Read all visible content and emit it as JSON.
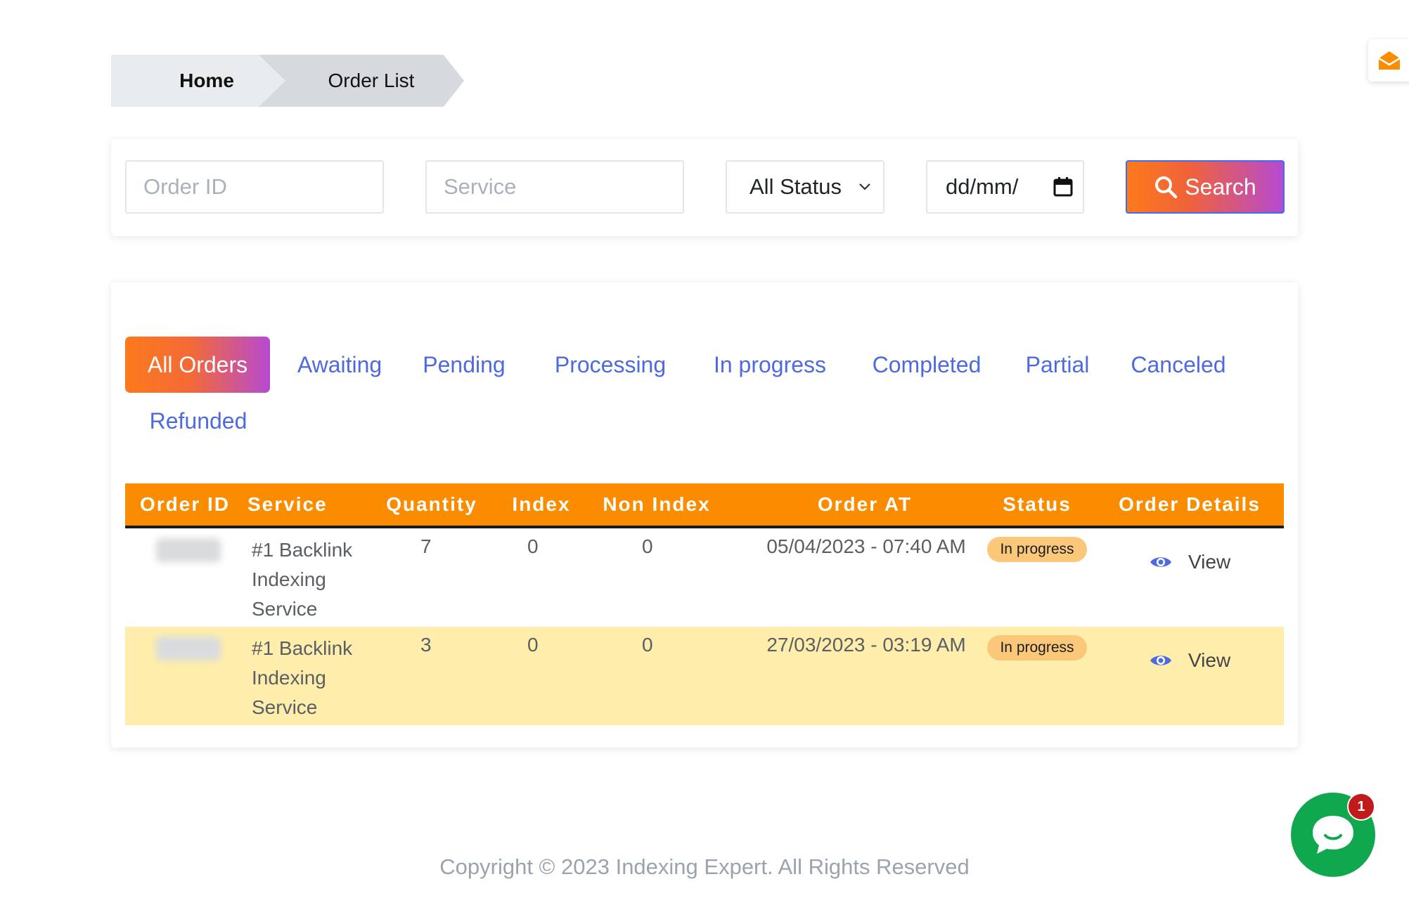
{
  "breadcrumb": {
    "home": "Home",
    "current": "Order List"
  },
  "filters": {
    "order_id_placeholder": "Order ID",
    "service_placeholder": "Service",
    "status_selected": "All Status",
    "date_placeholder": "dd/mm/yyyy",
    "date_display": "dd/mm/",
    "search_label": "Search"
  },
  "tabs": [
    {
      "label": "All Orders",
      "active": true
    },
    {
      "label": "Awaiting"
    },
    {
      "label": "Pending"
    },
    {
      "label": "Processing"
    },
    {
      "label": "In progress"
    },
    {
      "label": "Completed"
    },
    {
      "label": "Partial"
    },
    {
      "label": "Canceled"
    },
    {
      "label": "Refunded"
    }
  ],
  "table": {
    "headers": [
      "Order ID",
      "Service",
      "Quantity",
      "Index",
      "Non Index",
      "Order AT",
      "Status",
      "Order Details"
    ],
    "rows": [
      {
        "service_line1": "#1 Backlink",
        "service_line2": "Indexing",
        "service_line3": "Service",
        "quantity": "7",
        "index": "0",
        "non_index": "0",
        "order_at": "05/04/2023 - 07:40 AM",
        "status": "In progress",
        "details": "View"
      },
      {
        "service_line1": "#1 Backlink",
        "service_line2": "Indexing",
        "service_line3": "Service",
        "quantity": "3",
        "index": "0",
        "non_index": "0",
        "order_at": "27/03/2023 - 03:19 AM",
        "status": "In progress",
        "details": "View"
      }
    ]
  },
  "footer": {
    "copyright": "Copyright © 2023 Indexing Expert. All Rights Reserved"
  },
  "chat": {
    "badge_count": "1"
  },
  "colors": {
    "accent_orange": "#fb8c00",
    "tab_blue": "#4e6ae0",
    "chat_green": "#10a84e",
    "badge_bg": "#fbc879",
    "alt_row": "#ffeeab"
  },
  "icons": {
    "mail": "envelope-open-icon",
    "search": "magnifier-icon",
    "calendar": "calendar-icon",
    "chevron": "chevron-down-icon",
    "view": "eye-icon",
    "chat": "chat-bubble-icon"
  }
}
